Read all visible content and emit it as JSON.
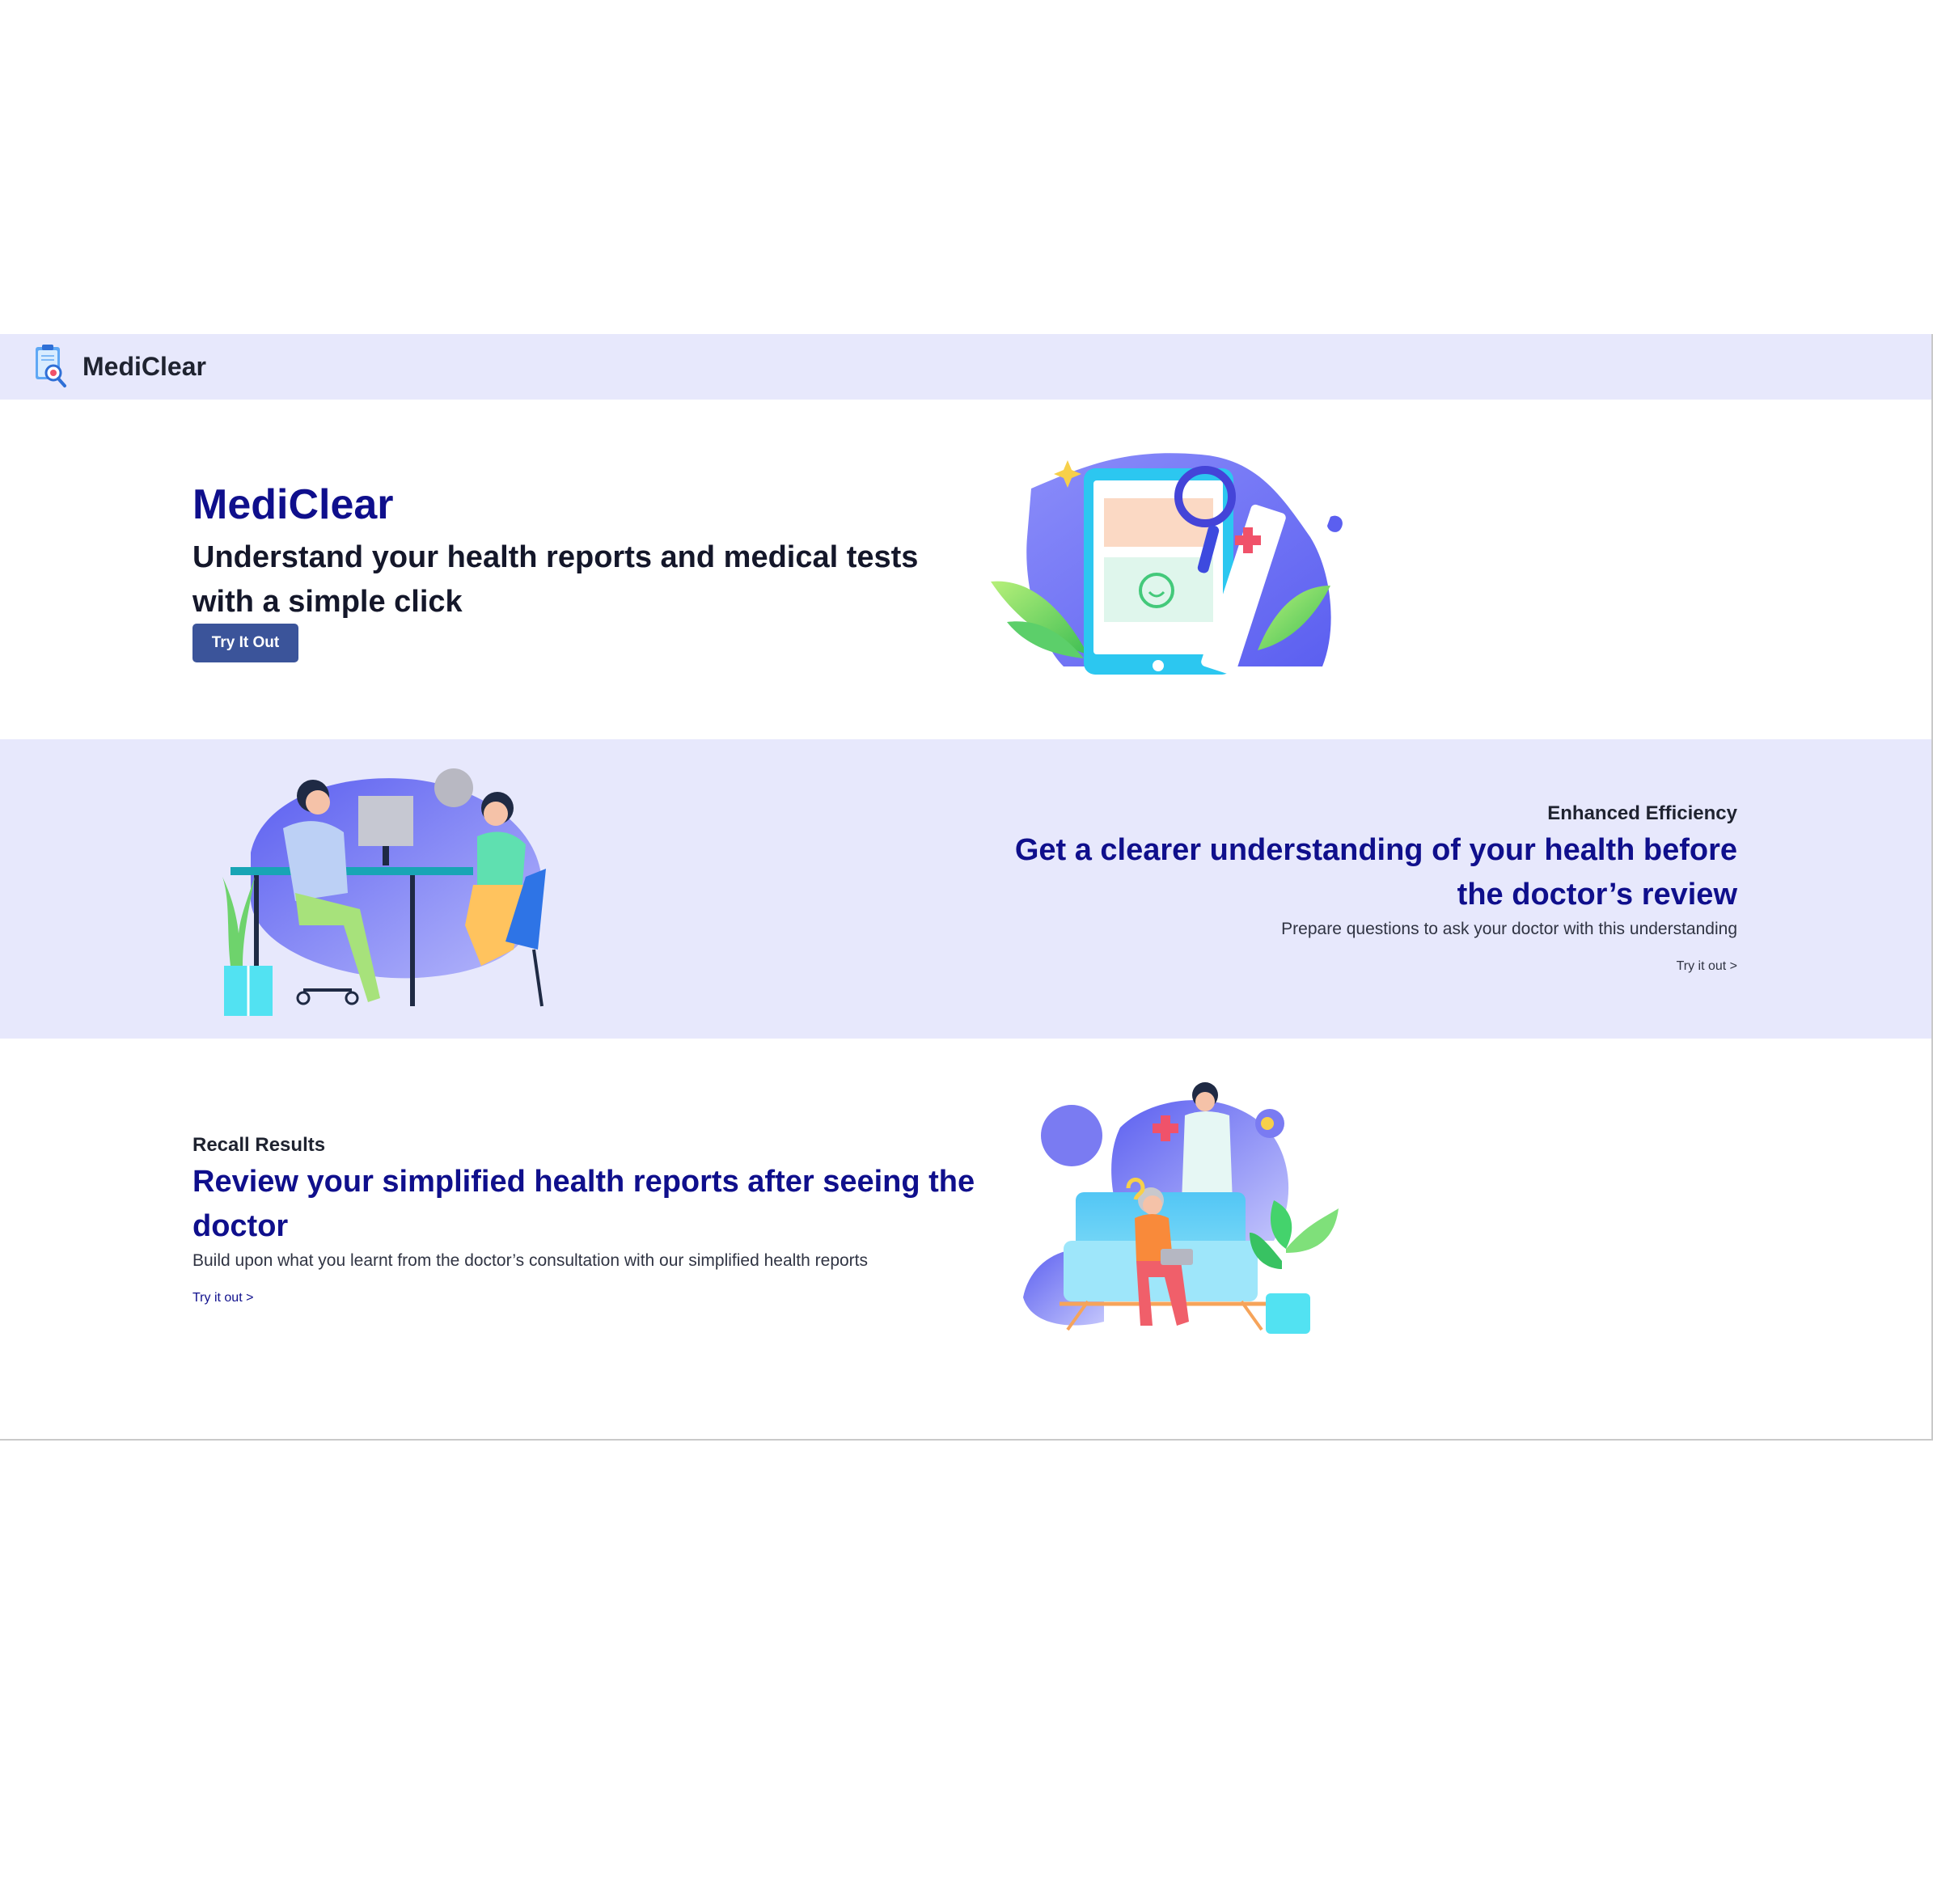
{
  "navbar": {
    "brand": "MediClear",
    "logo_icon": "clipboard-magnifier-icon"
  },
  "hero": {
    "title": "MediClear",
    "subtitle": "Understand your health reports and medical tests with a simple click",
    "cta_label": "Try It Out",
    "illustration": "tablet-medical-report-illustration"
  },
  "features": [
    {
      "eyebrow": "Enhanced Efficiency",
      "title": "Get a clearer understanding of your health before the doctor’s review",
      "description": "Prepare questions to ask your doctor with this understanding",
      "link_label": "Try it out >",
      "illustration": "doctor-consultation-illustration"
    },
    {
      "eyebrow": "Recall Results",
      "title": "Review your simplified health reports after seeing the doctor",
      "description": "Build upon what you learnt from the doctor’s consultation with our simplified health reports",
      "link_label": "Try it out >",
      "illustration": "patient-and-doctor-illustration"
    }
  ],
  "colors": {
    "accent": "#0f0f8c",
    "band": "#e7e8fc",
    "button": "#3b549a"
  }
}
